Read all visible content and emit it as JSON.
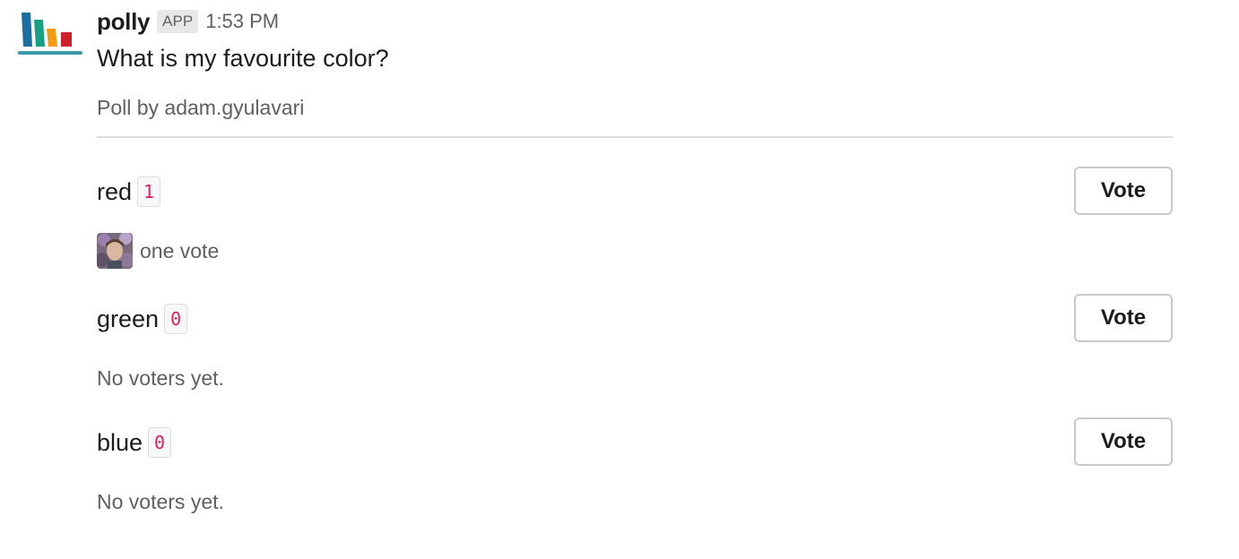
{
  "sender": {
    "name": "polly",
    "badge": "APP",
    "timestamp": "1:53 PM",
    "logo_icon": "bar-chart-logo-icon",
    "logo_colors": [
      "#1b6fa0",
      "#16a085",
      "#f39c12",
      "#d0202b",
      "#3a9aa8"
    ]
  },
  "poll": {
    "question": "What is my favourite color?",
    "author_line": "Poll by adam.gyulavari",
    "options": [
      {
        "label": "red",
        "count": "1",
        "vote_label": "Vote",
        "voters_text": "one vote",
        "has_voter_avatar": true
      },
      {
        "label": "green",
        "count": "0",
        "vote_label": "Vote",
        "voters_text": "No voters yet.",
        "has_voter_avatar": false
      },
      {
        "label": "blue",
        "count": "0",
        "vote_label": "Vote",
        "voters_text": "No voters yet.",
        "has_voter_avatar": false
      }
    ]
  },
  "colors": {
    "count_text": "#e01e5a",
    "muted_text": "#616061"
  }
}
